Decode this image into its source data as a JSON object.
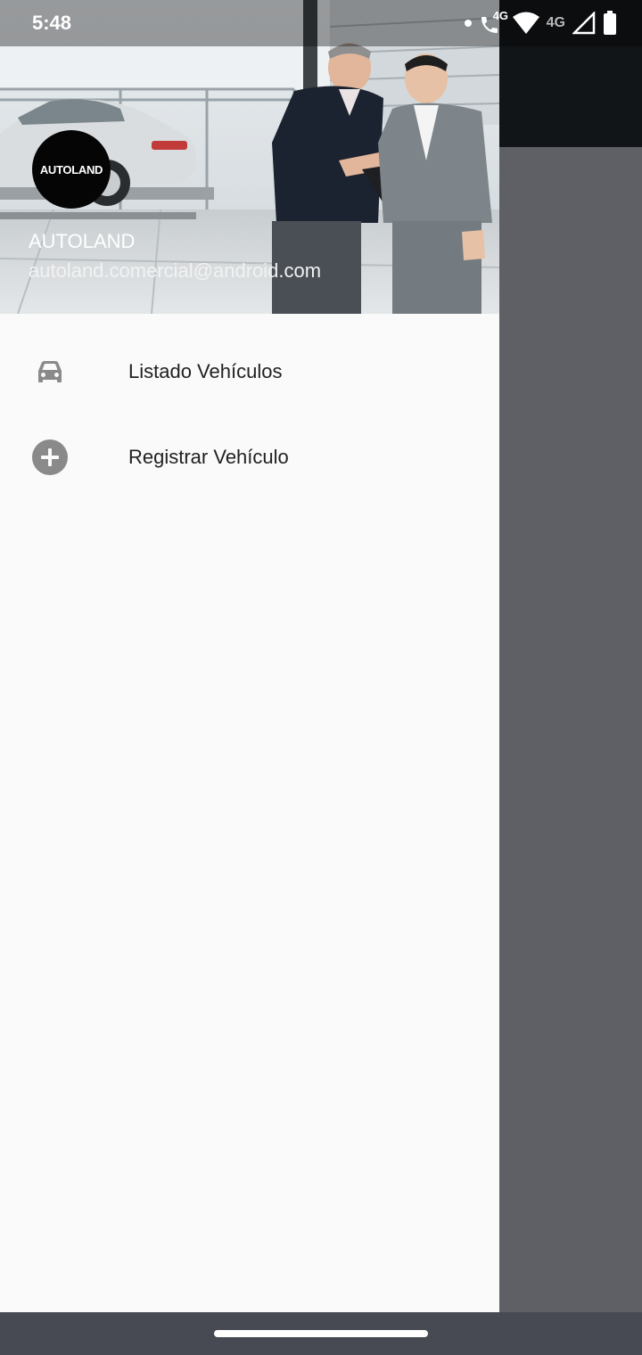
{
  "status_bar": {
    "time": "5:48",
    "icons": [
      "dot-icon",
      "wifi-call-icon",
      "wifi-icon",
      "signal-icon",
      "battery-icon"
    ],
    "wifi_call_label": "4G",
    "network_label": "4G"
  },
  "drawer": {
    "header": {
      "logo_text": "AUTOLAND",
      "name": "AUTOLAND",
      "email": "autoland.comercial@android.com"
    },
    "items": [
      {
        "label": "Listado Vehículos",
        "icon": "car-icon"
      },
      {
        "label": "Registrar Vehículo",
        "icon": "add-circle-icon"
      }
    ]
  },
  "colors": {
    "drawer_bg": "#fafafa",
    "icon_gray": "#8a8a8a",
    "scrim": "#5f6065",
    "appbar": "#121517",
    "navbar": "#474a52"
  }
}
